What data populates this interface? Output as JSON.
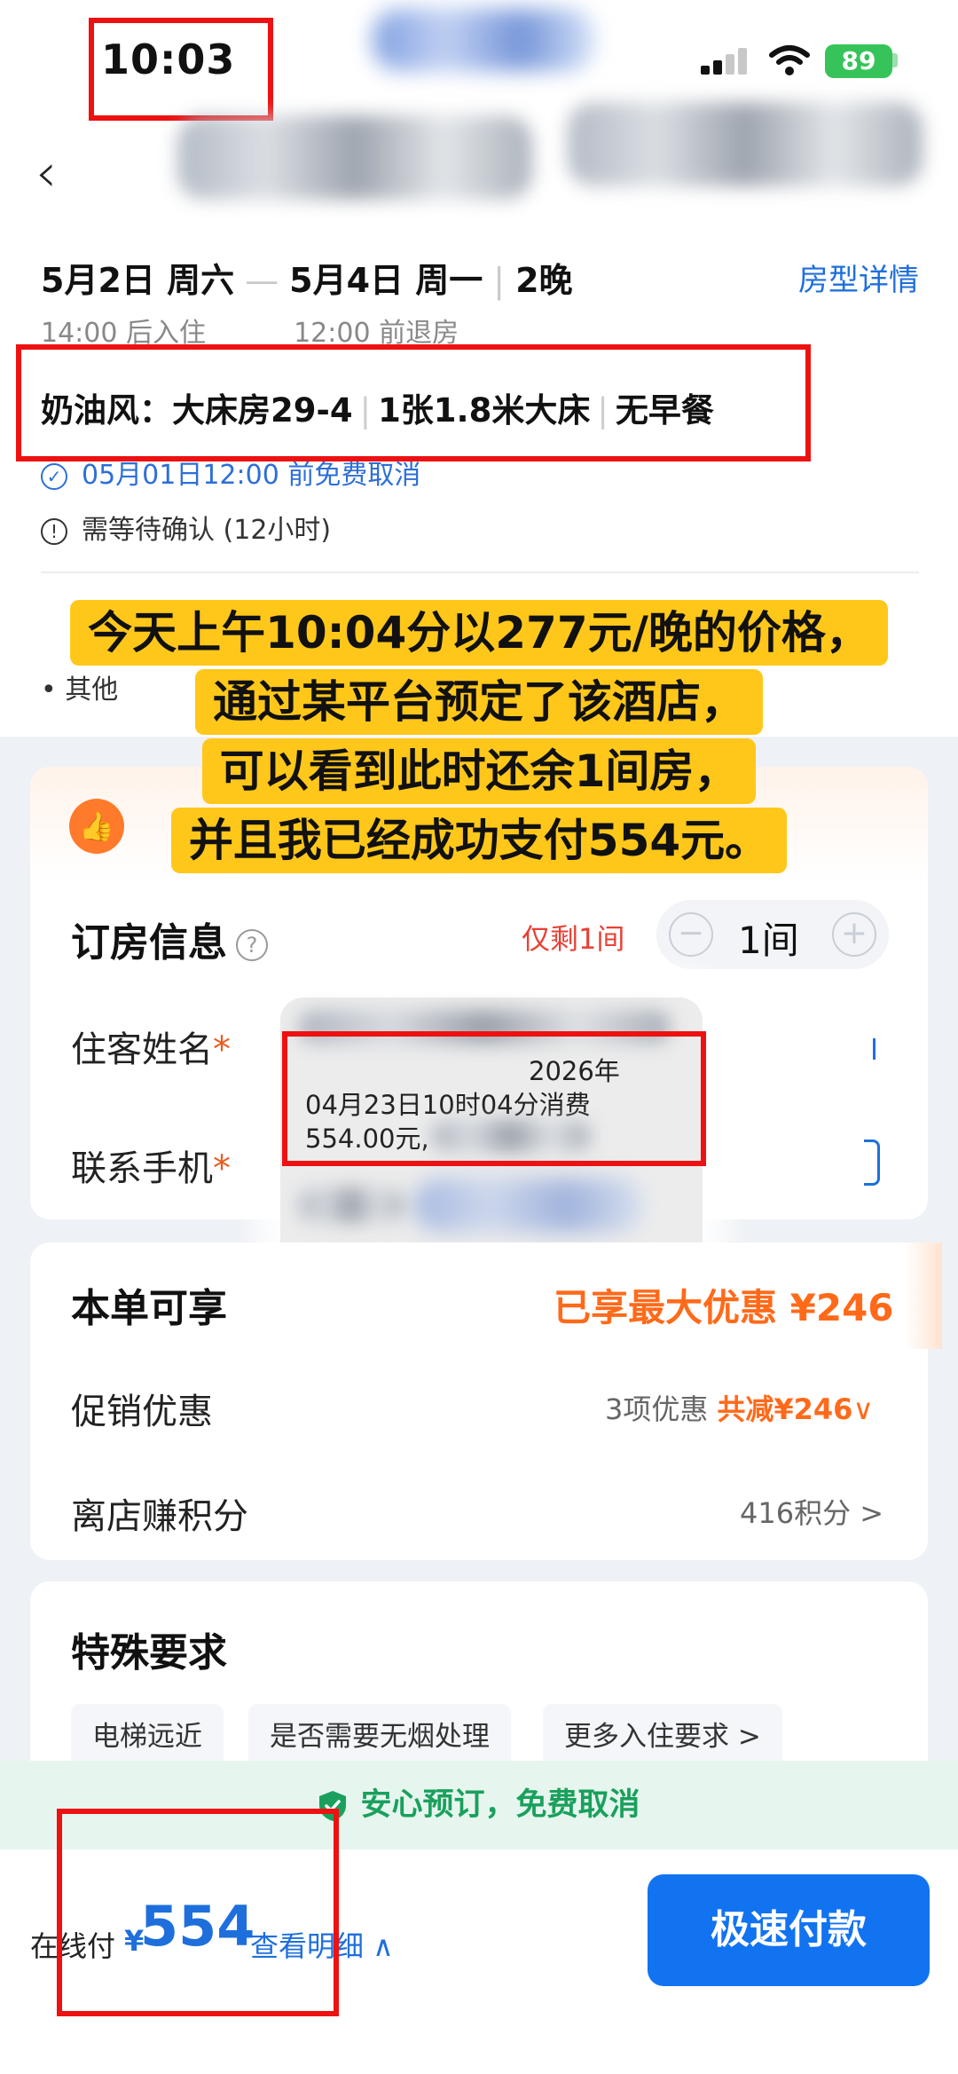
{
  "status_bar": {
    "time": "10:03",
    "battery": "89"
  },
  "header": {
    "back_icon": "chevron-left-icon"
  },
  "stay": {
    "check_in": "5月2日 周六",
    "check_out": "5月4日 周一",
    "nights": "2晚",
    "room_details_link": "房型详情",
    "check_in_time": "14:00 后入住",
    "check_out_time": "12:00 前退房"
  },
  "room": {
    "name": "奶油风：大床房29-4",
    "bed": "1张1.8米大床",
    "breakfast": "无早餐",
    "cancel_policy": "05月01日12:00 前免费取消",
    "confirm_note": "需等待确认 (12小时)",
    "other": "其他"
  },
  "annotation": {
    "lines": [
      "今天上午10:04分以277元/晚的价格，",
      "通过某平台预定了该酒店，",
      "可以看到此时还余1间房，",
      "并且我已经成功支付554元。"
    ]
  },
  "booking": {
    "title": "订房信息",
    "only_left": "仅剩1间",
    "rooms_value": "1间",
    "guest_name_label": "住客姓名",
    "phone_label": "联系手机",
    "required_mark": "*"
  },
  "sms": {
    "year": "2026年",
    "line2": "04月23日10时04分消费",
    "line3": "554.00元,"
  },
  "benefits": {
    "title": "本单可享",
    "max_discount": "已享最大优惠 ¥246",
    "promo_label": "促销优惠",
    "promo_count": "3项优惠",
    "promo_total": "共减¥246",
    "points_label": "离店赚积分",
    "points_value": "416积分 >"
  },
  "special": {
    "title": "特殊要求",
    "chips": [
      "电梯远近",
      "是否需要无烟处理",
      "更多入住要求 >"
    ]
  },
  "safe_banner": "安心预订，免费取消",
  "footer": {
    "online_pay_label": "在线付",
    "currency": "¥",
    "price": "554",
    "view_detail": "查看明细",
    "pay_button": "极速付款"
  },
  "colors": {
    "accent_blue": "#1273f1",
    "link_blue": "#1e6fdc",
    "discount_orange": "#ff6a1a",
    "annotation_yellow": "#ffc71a",
    "highlight_red": "#ee1111",
    "safe_green": "#1aa05c"
  }
}
